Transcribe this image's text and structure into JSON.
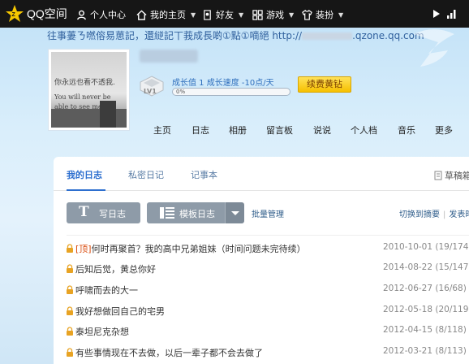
{
  "topbar": {
    "brand": "QQ空间",
    "items": [
      {
        "label": "个人中心",
        "icon": "user-icon",
        "caret": false
      },
      {
        "label": "我的主页",
        "icon": "home-icon",
        "caret": true
      },
      {
        "label": "好友",
        "icon": "friends-icon",
        "caret": true
      },
      {
        "label": "游戏",
        "icon": "grid-icon",
        "caret": true
      },
      {
        "label": "装扮",
        "icon": "shirt-icon",
        "caret": true
      }
    ],
    "right_icons": [
      "play-icon",
      "signal-icon"
    ]
  },
  "header": {
    "motto_prefix": "往事萋ㄋ嘫傛易葸記，還縌記丅莪成長啲①點①嘀絕 http://",
    "motto_suffix": ".qzone.qq.com",
    "avatar_text_1": "你永远也看不透我.",
    "avatar_text_2": "You will never be able to see me.",
    "level_label": "LV1",
    "growth_text": "成长值 1   成长速度 -10点/天",
    "growth_percent": 0,
    "growth_percent_label": "0%",
    "renew_button": "续费黄钻"
  },
  "mainnav": [
    "主页",
    "日志",
    "相册",
    "留言板",
    "说说",
    "个人档",
    "音乐",
    "更多"
  ],
  "panel": {
    "tabs": [
      {
        "label": "我的日志",
        "active": true
      },
      {
        "label": "私密日记",
        "active": false
      },
      {
        "label": "记事本",
        "active": false
      }
    ],
    "drafts_label": "草稿箱",
    "write_button": "写日志",
    "template_button": "模板日志",
    "batch_label": "批量管理",
    "switch_label": "切换到摘要",
    "publish_label": "发表时"
  },
  "entries": [
    {
      "top_tag": "[顶]",
      "title": "何时再聚首？我的高中兄弟姐妹（时间问题未完待续）",
      "date": "2010-10-01",
      "stats": "(19/174)"
    },
    {
      "top_tag": "",
      "title": "后知后觉，黄总你好",
      "date": "2014-08-22",
      "stats": "(15/147)"
    },
    {
      "top_tag": "",
      "title": "呼啸而去的大一",
      "date": "2012-06-27",
      "stats": "(16/68)"
    },
    {
      "top_tag": "",
      "title": "我好想做回自己的宅男",
      "date": "2012-05-18",
      "stats": "(20/119)"
    },
    {
      "top_tag": "",
      "title": "泰坦尼克杂想",
      "date": "2012-04-15",
      "stats": "(8/118)"
    },
    {
      "top_tag": "",
      "title": "有些事情现在不去做，以后一辈子都不会去做了",
      "date": "2012-03-21",
      "stats": "(8/113)"
    }
  ],
  "colors": {
    "accent": "#2d6fcf",
    "topbar": "#161616",
    "gold": "#f6c000",
    "lock": "#e8a323"
  }
}
